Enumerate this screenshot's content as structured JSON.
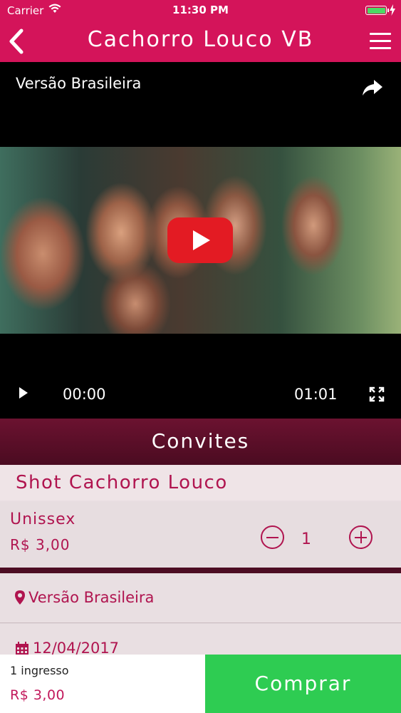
{
  "status_bar": {
    "carrier": "Carrier",
    "time": "11:30 PM"
  },
  "nav": {
    "title": "Cachorro Louco VB"
  },
  "video": {
    "title": "Versão Brasileira",
    "current_time": "00:00",
    "duration": "01:01"
  },
  "section": {
    "title": "Convites"
  },
  "ticket": {
    "name": "Shot Cachorro Louco",
    "type": "Unissex",
    "price": "R$ 3,00",
    "quantity": "1"
  },
  "event": {
    "venue": "Versão Brasileira",
    "date": "12/04/2017"
  },
  "checkout": {
    "count_label": "1 ingresso",
    "total": "R$ 3,00",
    "buy_label": "Comprar"
  },
  "colors": {
    "brand": "#d4145a",
    "accent_text": "#b0144f",
    "buy_button": "#2ecc52"
  }
}
